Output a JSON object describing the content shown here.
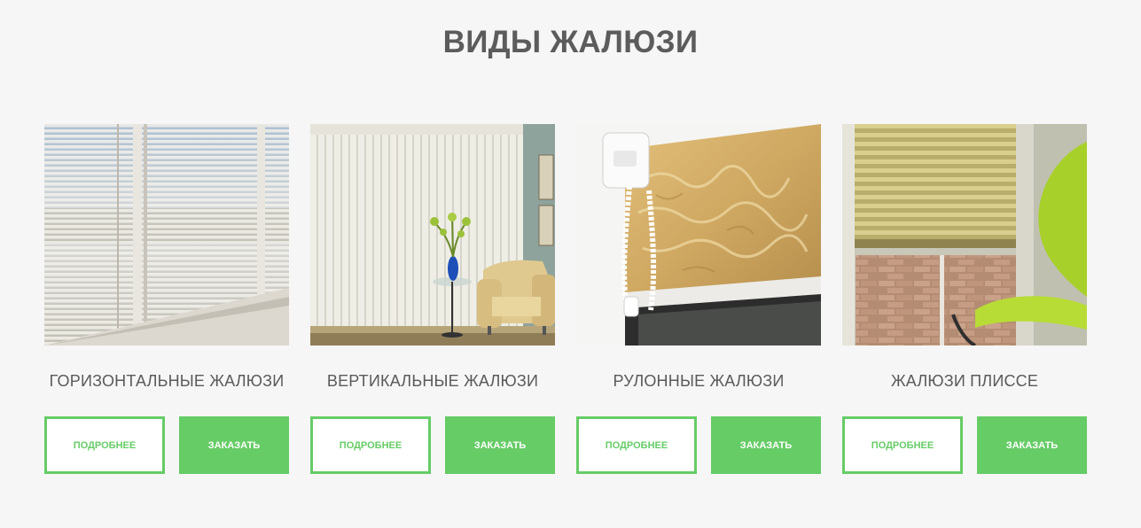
{
  "page": {
    "title": "ВИДЫ ЖАЛЮЗИ"
  },
  "theme": {
    "accent": "#66cc66",
    "background": "#f6f6f6",
    "text": "#5a5a5a"
  },
  "cards": [
    {
      "title": "ГОРИЗОНТАЛЬНЫЕ ЖАЛЮЗИ",
      "more_label": "ПОДРОБНЕЕ",
      "order_label": "ЗАКАЗАТЬ",
      "image_alt": "horizontal-blinds-photo"
    },
    {
      "title": "ВЕРТИКАЛЬНЫЕ ЖАЛЮЗИ",
      "more_label": "ПОДРОБНЕЕ",
      "order_label": "ЗАКАЗАТЬ",
      "image_alt": "vertical-blinds-photo"
    },
    {
      "title": "РУЛОННЫЕ ЖАЛЮЗИ",
      "more_label": "ПОДРОБНЕЕ",
      "order_label": "ЗАКАЗАТЬ",
      "image_alt": "roller-blinds-photo"
    },
    {
      "title": "ЖАЛЮЗИ ПЛИССЕ",
      "more_label": "ПОДРОБНЕЕ",
      "order_label": "ЗАКАЗАТЬ",
      "image_alt": "pleated-blinds-photo"
    }
  ]
}
